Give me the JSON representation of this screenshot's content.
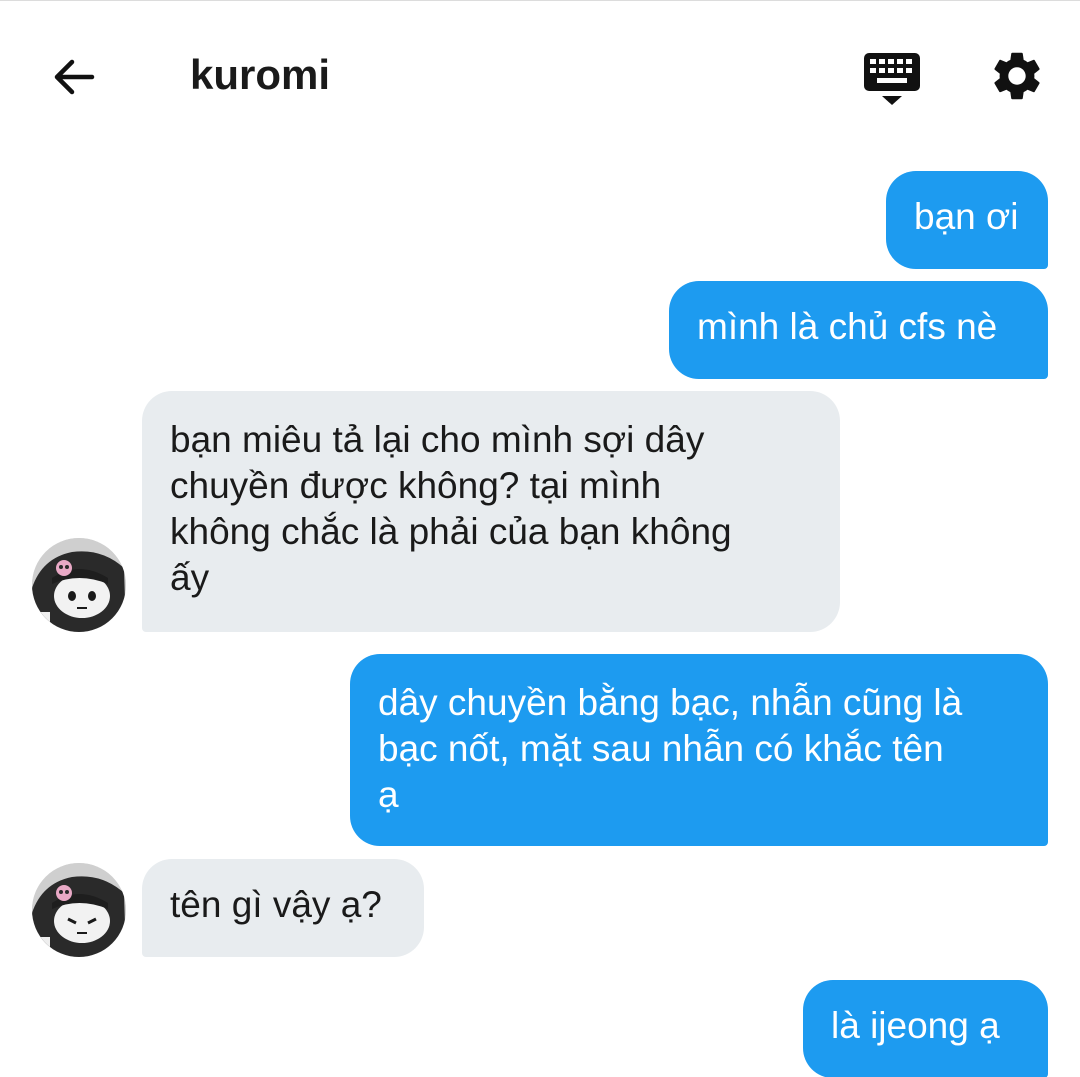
{
  "header": {
    "title": "kuromi"
  },
  "icons": {
    "back": "arrow-back-icon",
    "keyboard": "keyboard-icon",
    "settings": "gear-icon"
  },
  "colors": {
    "outgoing_bubble": "#1d9bf0",
    "incoming_bubble": "#e8ecef"
  },
  "messages": [
    {
      "direction": "outgoing",
      "text": "bạn ơi"
    },
    {
      "direction": "outgoing",
      "text": "mình là chủ cfs nè"
    },
    {
      "direction": "incoming",
      "lines": [
        "bạn miêu tả lại cho mình sợi dây",
        "chuyền được không? tại mình",
        "không chắc là phải của bạn không",
        "ấy"
      ]
    },
    {
      "direction": "outgoing",
      "lines": [
        "dây chuyền bằng bạc, nhẫn cũng là",
        "bạc nốt, mặt sau nhẫn có khắc tên",
        "ạ"
      ]
    },
    {
      "direction": "incoming",
      "text": "tên gì vậy ạ?"
    },
    {
      "direction": "outgoing",
      "text": "là ijeong ạ"
    }
  ]
}
